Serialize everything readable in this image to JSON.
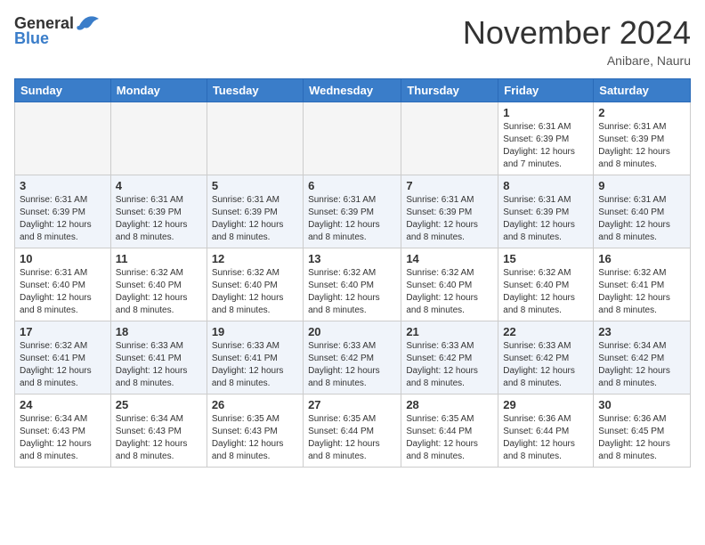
{
  "logo": {
    "text_general": "General",
    "text_blue": "Blue"
  },
  "header": {
    "month": "November 2024",
    "location": "Anibare, Nauru"
  },
  "weekdays": [
    "Sunday",
    "Monday",
    "Tuesday",
    "Wednesday",
    "Thursday",
    "Friday",
    "Saturday"
  ],
  "weeks": [
    {
      "days": [
        {
          "num": "",
          "info": ""
        },
        {
          "num": "",
          "info": ""
        },
        {
          "num": "",
          "info": ""
        },
        {
          "num": "",
          "info": ""
        },
        {
          "num": "",
          "info": ""
        },
        {
          "num": "1",
          "info": "Sunrise: 6:31 AM\nSunset: 6:39 PM\nDaylight: 12 hours and 7 minutes."
        },
        {
          "num": "2",
          "info": "Sunrise: 6:31 AM\nSunset: 6:39 PM\nDaylight: 12 hours and 8 minutes."
        }
      ]
    },
    {
      "days": [
        {
          "num": "3",
          "info": "Sunrise: 6:31 AM\nSunset: 6:39 PM\nDaylight: 12 hours and 8 minutes."
        },
        {
          "num": "4",
          "info": "Sunrise: 6:31 AM\nSunset: 6:39 PM\nDaylight: 12 hours and 8 minutes."
        },
        {
          "num": "5",
          "info": "Sunrise: 6:31 AM\nSunset: 6:39 PM\nDaylight: 12 hours and 8 minutes."
        },
        {
          "num": "6",
          "info": "Sunrise: 6:31 AM\nSunset: 6:39 PM\nDaylight: 12 hours and 8 minutes."
        },
        {
          "num": "7",
          "info": "Sunrise: 6:31 AM\nSunset: 6:39 PM\nDaylight: 12 hours and 8 minutes."
        },
        {
          "num": "8",
          "info": "Sunrise: 6:31 AM\nSunset: 6:39 PM\nDaylight: 12 hours and 8 minutes."
        },
        {
          "num": "9",
          "info": "Sunrise: 6:31 AM\nSunset: 6:40 PM\nDaylight: 12 hours and 8 minutes."
        }
      ]
    },
    {
      "days": [
        {
          "num": "10",
          "info": "Sunrise: 6:31 AM\nSunset: 6:40 PM\nDaylight: 12 hours and 8 minutes."
        },
        {
          "num": "11",
          "info": "Sunrise: 6:32 AM\nSunset: 6:40 PM\nDaylight: 12 hours and 8 minutes."
        },
        {
          "num": "12",
          "info": "Sunrise: 6:32 AM\nSunset: 6:40 PM\nDaylight: 12 hours and 8 minutes."
        },
        {
          "num": "13",
          "info": "Sunrise: 6:32 AM\nSunset: 6:40 PM\nDaylight: 12 hours and 8 minutes."
        },
        {
          "num": "14",
          "info": "Sunrise: 6:32 AM\nSunset: 6:40 PM\nDaylight: 12 hours and 8 minutes."
        },
        {
          "num": "15",
          "info": "Sunrise: 6:32 AM\nSunset: 6:40 PM\nDaylight: 12 hours and 8 minutes."
        },
        {
          "num": "16",
          "info": "Sunrise: 6:32 AM\nSunset: 6:41 PM\nDaylight: 12 hours and 8 minutes."
        }
      ]
    },
    {
      "days": [
        {
          "num": "17",
          "info": "Sunrise: 6:32 AM\nSunset: 6:41 PM\nDaylight: 12 hours and 8 minutes."
        },
        {
          "num": "18",
          "info": "Sunrise: 6:33 AM\nSunset: 6:41 PM\nDaylight: 12 hours and 8 minutes."
        },
        {
          "num": "19",
          "info": "Sunrise: 6:33 AM\nSunset: 6:41 PM\nDaylight: 12 hours and 8 minutes."
        },
        {
          "num": "20",
          "info": "Sunrise: 6:33 AM\nSunset: 6:42 PM\nDaylight: 12 hours and 8 minutes."
        },
        {
          "num": "21",
          "info": "Sunrise: 6:33 AM\nSunset: 6:42 PM\nDaylight: 12 hours and 8 minutes."
        },
        {
          "num": "22",
          "info": "Sunrise: 6:33 AM\nSunset: 6:42 PM\nDaylight: 12 hours and 8 minutes."
        },
        {
          "num": "23",
          "info": "Sunrise: 6:34 AM\nSunset: 6:42 PM\nDaylight: 12 hours and 8 minutes."
        }
      ]
    },
    {
      "days": [
        {
          "num": "24",
          "info": "Sunrise: 6:34 AM\nSunset: 6:43 PM\nDaylight: 12 hours and 8 minutes."
        },
        {
          "num": "25",
          "info": "Sunrise: 6:34 AM\nSunset: 6:43 PM\nDaylight: 12 hours and 8 minutes."
        },
        {
          "num": "26",
          "info": "Sunrise: 6:35 AM\nSunset: 6:43 PM\nDaylight: 12 hours and 8 minutes."
        },
        {
          "num": "27",
          "info": "Sunrise: 6:35 AM\nSunset: 6:44 PM\nDaylight: 12 hours and 8 minutes."
        },
        {
          "num": "28",
          "info": "Sunrise: 6:35 AM\nSunset: 6:44 PM\nDaylight: 12 hours and 8 minutes."
        },
        {
          "num": "29",
          "info": "Sunrise: 6:36 AM\nSunset: 6:44 PM\nDaylight: 12 hours and 8 minutes."
        },
        {
          "num": "30",
          "info": "Sunrise: 6:36 AM\nSunset: 6:45 PM\nDaylight: 12 hours and 8 minutes."
        }
      ]
    }
  ]
}
